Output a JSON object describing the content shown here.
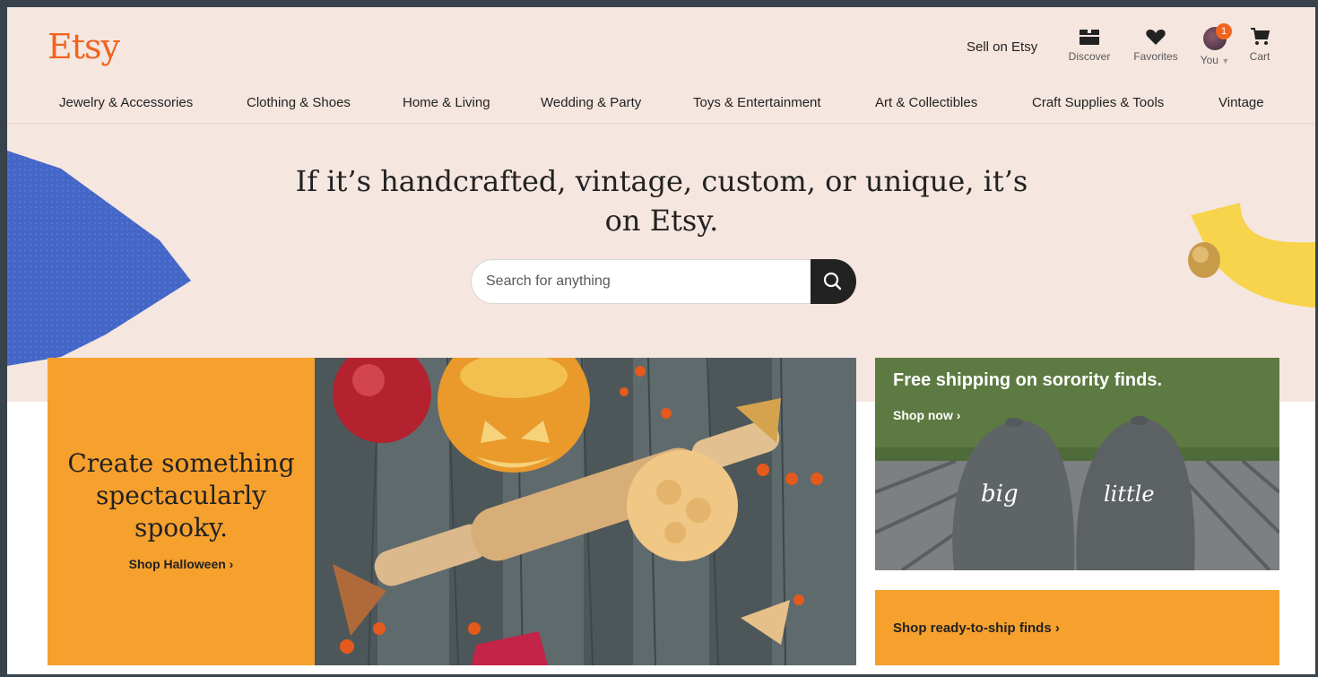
{
  "header": {
    "logo": "Etsy",
    "sell_label": "Sell on Etsy",
    "icons": [
      {
        "label": "Discover",
        "icon": "discover-icon"
      },
      {
        "label": "Favorites",
        "icon": "heart-icon"
      },
      {
        "label": "You",
        "icon": "avatar"
      },
      {
        "label": "Cart",
        "icon": "cart-icon"
      }
    ],
    "notification_count": "1"
  },
  "categories": [
    "Jewelry & Accessories",
    "Clothing & Shoes",
    "Home & Living",
    "Wedding & Party",
    "Toys & Entertainment",
    "Art & Collectibles",
    "Craft Supplies & Tools",
    "Vintage"
  ],
  "hero": {
    "tagline": "If it’s handcrafted, vintage, custom, or unique, it’s on Etsy."
  },
  "search": {
    "placeholder": "Search for anything"
  },
  "promo_main": {
    "headline": "Create something spectacularly spooky.",
    "link": "Shop Halloween ›"
  },
  "promo_side": {
    "title": "Free shipping on sorority finds.",
    "link": "Shop now ›",
    "cap_left_text": "big",
    "cap_right_text": "little"
  },
  "promo_ready": {
    "link": "Shop ready-to-ship finds ›"
  },
  "colors": {
    "brand": "#f1641e",
    "header_bg": "#f5e6e0",
    "promo_orange": "#f6a02e",
    "frame": "#37424b"
  }
}
